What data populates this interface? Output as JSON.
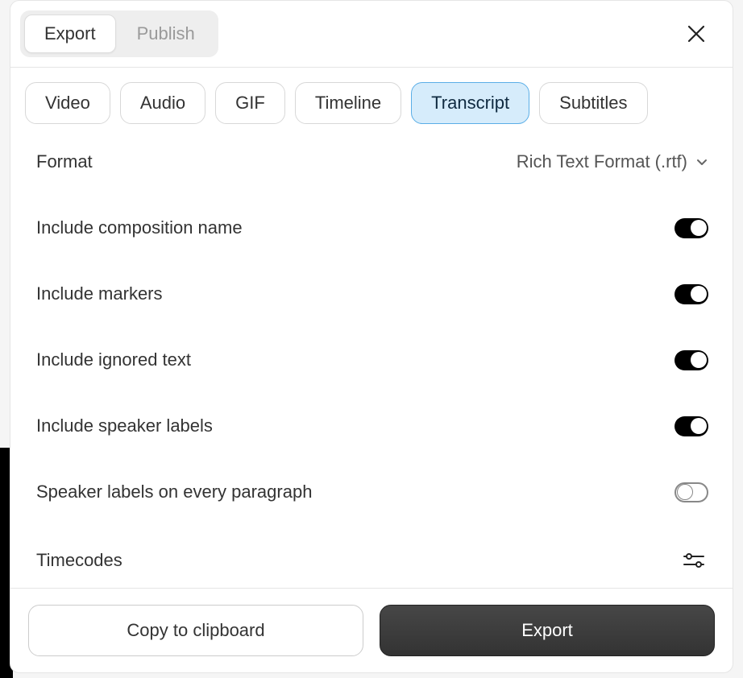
{
  "header": {
    "tabs": [
      {
        "label": "Export",
        "active": true
      },
      {
        "label": "Publish",
        "active": false
      }
    ]
  },
  "sub_tabs": [
    {
      "label": "Video",
      "active": false
    },
    {
      "label": "Audio",
      "active": false
    },
    {
      "label": "GIF",
      "active": false
    },
    {
      "label": "Timeline",
      "active": false
    },
    {
      "label": "Transcript",
      "active": true
    },
    {
      "label": "Subtitles",
      "active": false
    }
  ],
  "format": {
    "label": "Format",
    "value": "Rich Text Format (.rtf)"
  },
  "options": [
    {
      "label": "Include composition name",
      "on": true
    },
    {
      "label": "Include markers",
      "on": true
    },
    {
      "label": "Include ignored text",
      "on": true
    },
    {
      "label": "Include speaker labels",
      "on": true
    },
    {
      "label": "Speaker labels on every paragraph",
      "on": false
    }
  ],
  "timecodes": {
    "label": "Timecodes"
  },
  "footer": {
    "secondary": "Copy to clipboard",
    "primary": "Export"
  }
}
